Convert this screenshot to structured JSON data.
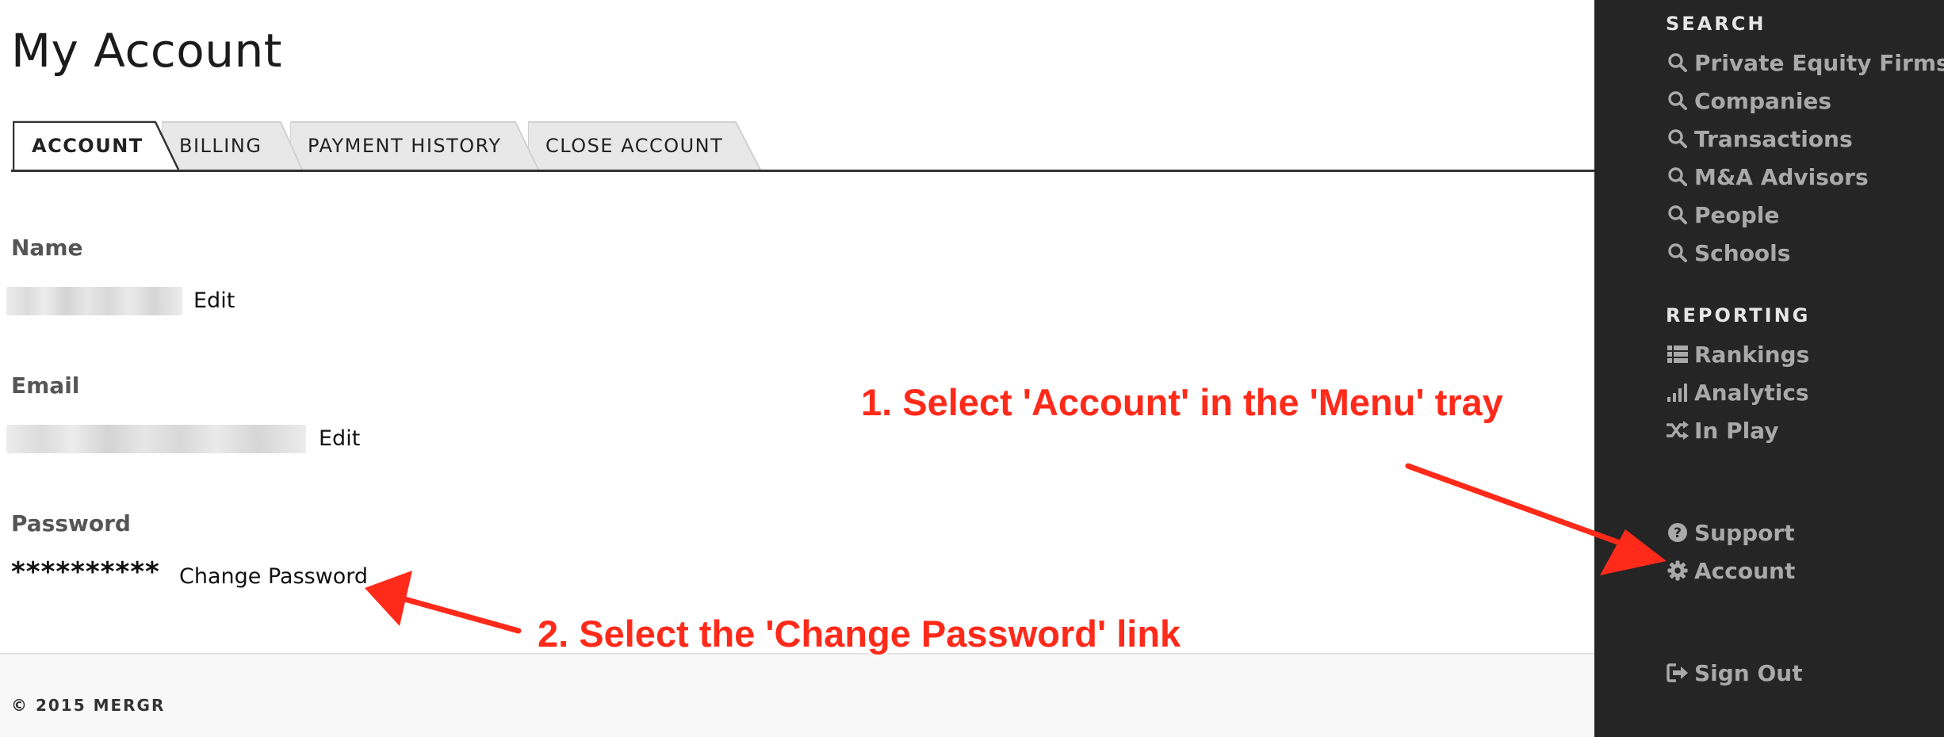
{
  "page": {
    "title": "My Account"
  },
  "tabs": [
    {
      "label": "ACCOUNT",
      "active": true
    },
    {
      "label": "BILLING",
      "active": false
    },
    {
      "label": "PAYMENT HISTORY",
      "active": false
    },
    {
      "label": "CLOSE ACCOUNT",
      "active": false
    }
  ],
  "fields": {
    "name": {
      "label": "Name",
      "edit_label": "Edit"
    },
    "email": {
      "label": "Email",
      "edit_label": "Edit"
    },
    "password": {
      "label": "Password",
      "masked_value": "**********",
      "change_label": "Change Password"
    }
  },
  "footer": {
    "copyright": "© 2015 MERGR"
  },
  "annotations": {
    "step1": "1. Select 'Account' in the 'Menu' tray",
    "step2": "2. Select the 'Change Password' link",
    "color": "#ff2a1a"
  },
  "sidebar": {
    "search_heading": "SEARCH",
    "search_items": [
      {
        "label": "Private Equity Firms",
        "icon": "search-icon"
      },
      {
        "label": "Companies",
        "icon": "search-icon"
      },
      {
        "label": "Transactions",
        "icon": "search-icon"
      },
      {
        "label": "M&A Advisors",
        "icon": "search-icon"
      },
      {
        "label": "People",
        "icon": "search-icon"
      },
      {
        "label": "Schools",
        "icon": "search-icon"
      }
    ],
    "reporting_heading": "REPORTING",
    "reporting_items": [
      {
        "label": "Rankings",
        "icon": "list-icon"
      },
      {
        "label": "Analytics",
        "icon": "signal-bars-icon"
      },
      {
        "label": "In Play",
        "icon": "shuffle-icon"
      }
    ],
    "support": {
      "label": "Support",
      "icon": "question-circle-icon"
    },
    "account": {
      "label": "Account",
      "icon": "gear-icon"
    },
    "sign_out": {
      "label": "Sign Out",
      "icon": "sign-out-icon"
    },
    "background": "#252525",
    "text_color": "#a9a9a9"
  }
}
